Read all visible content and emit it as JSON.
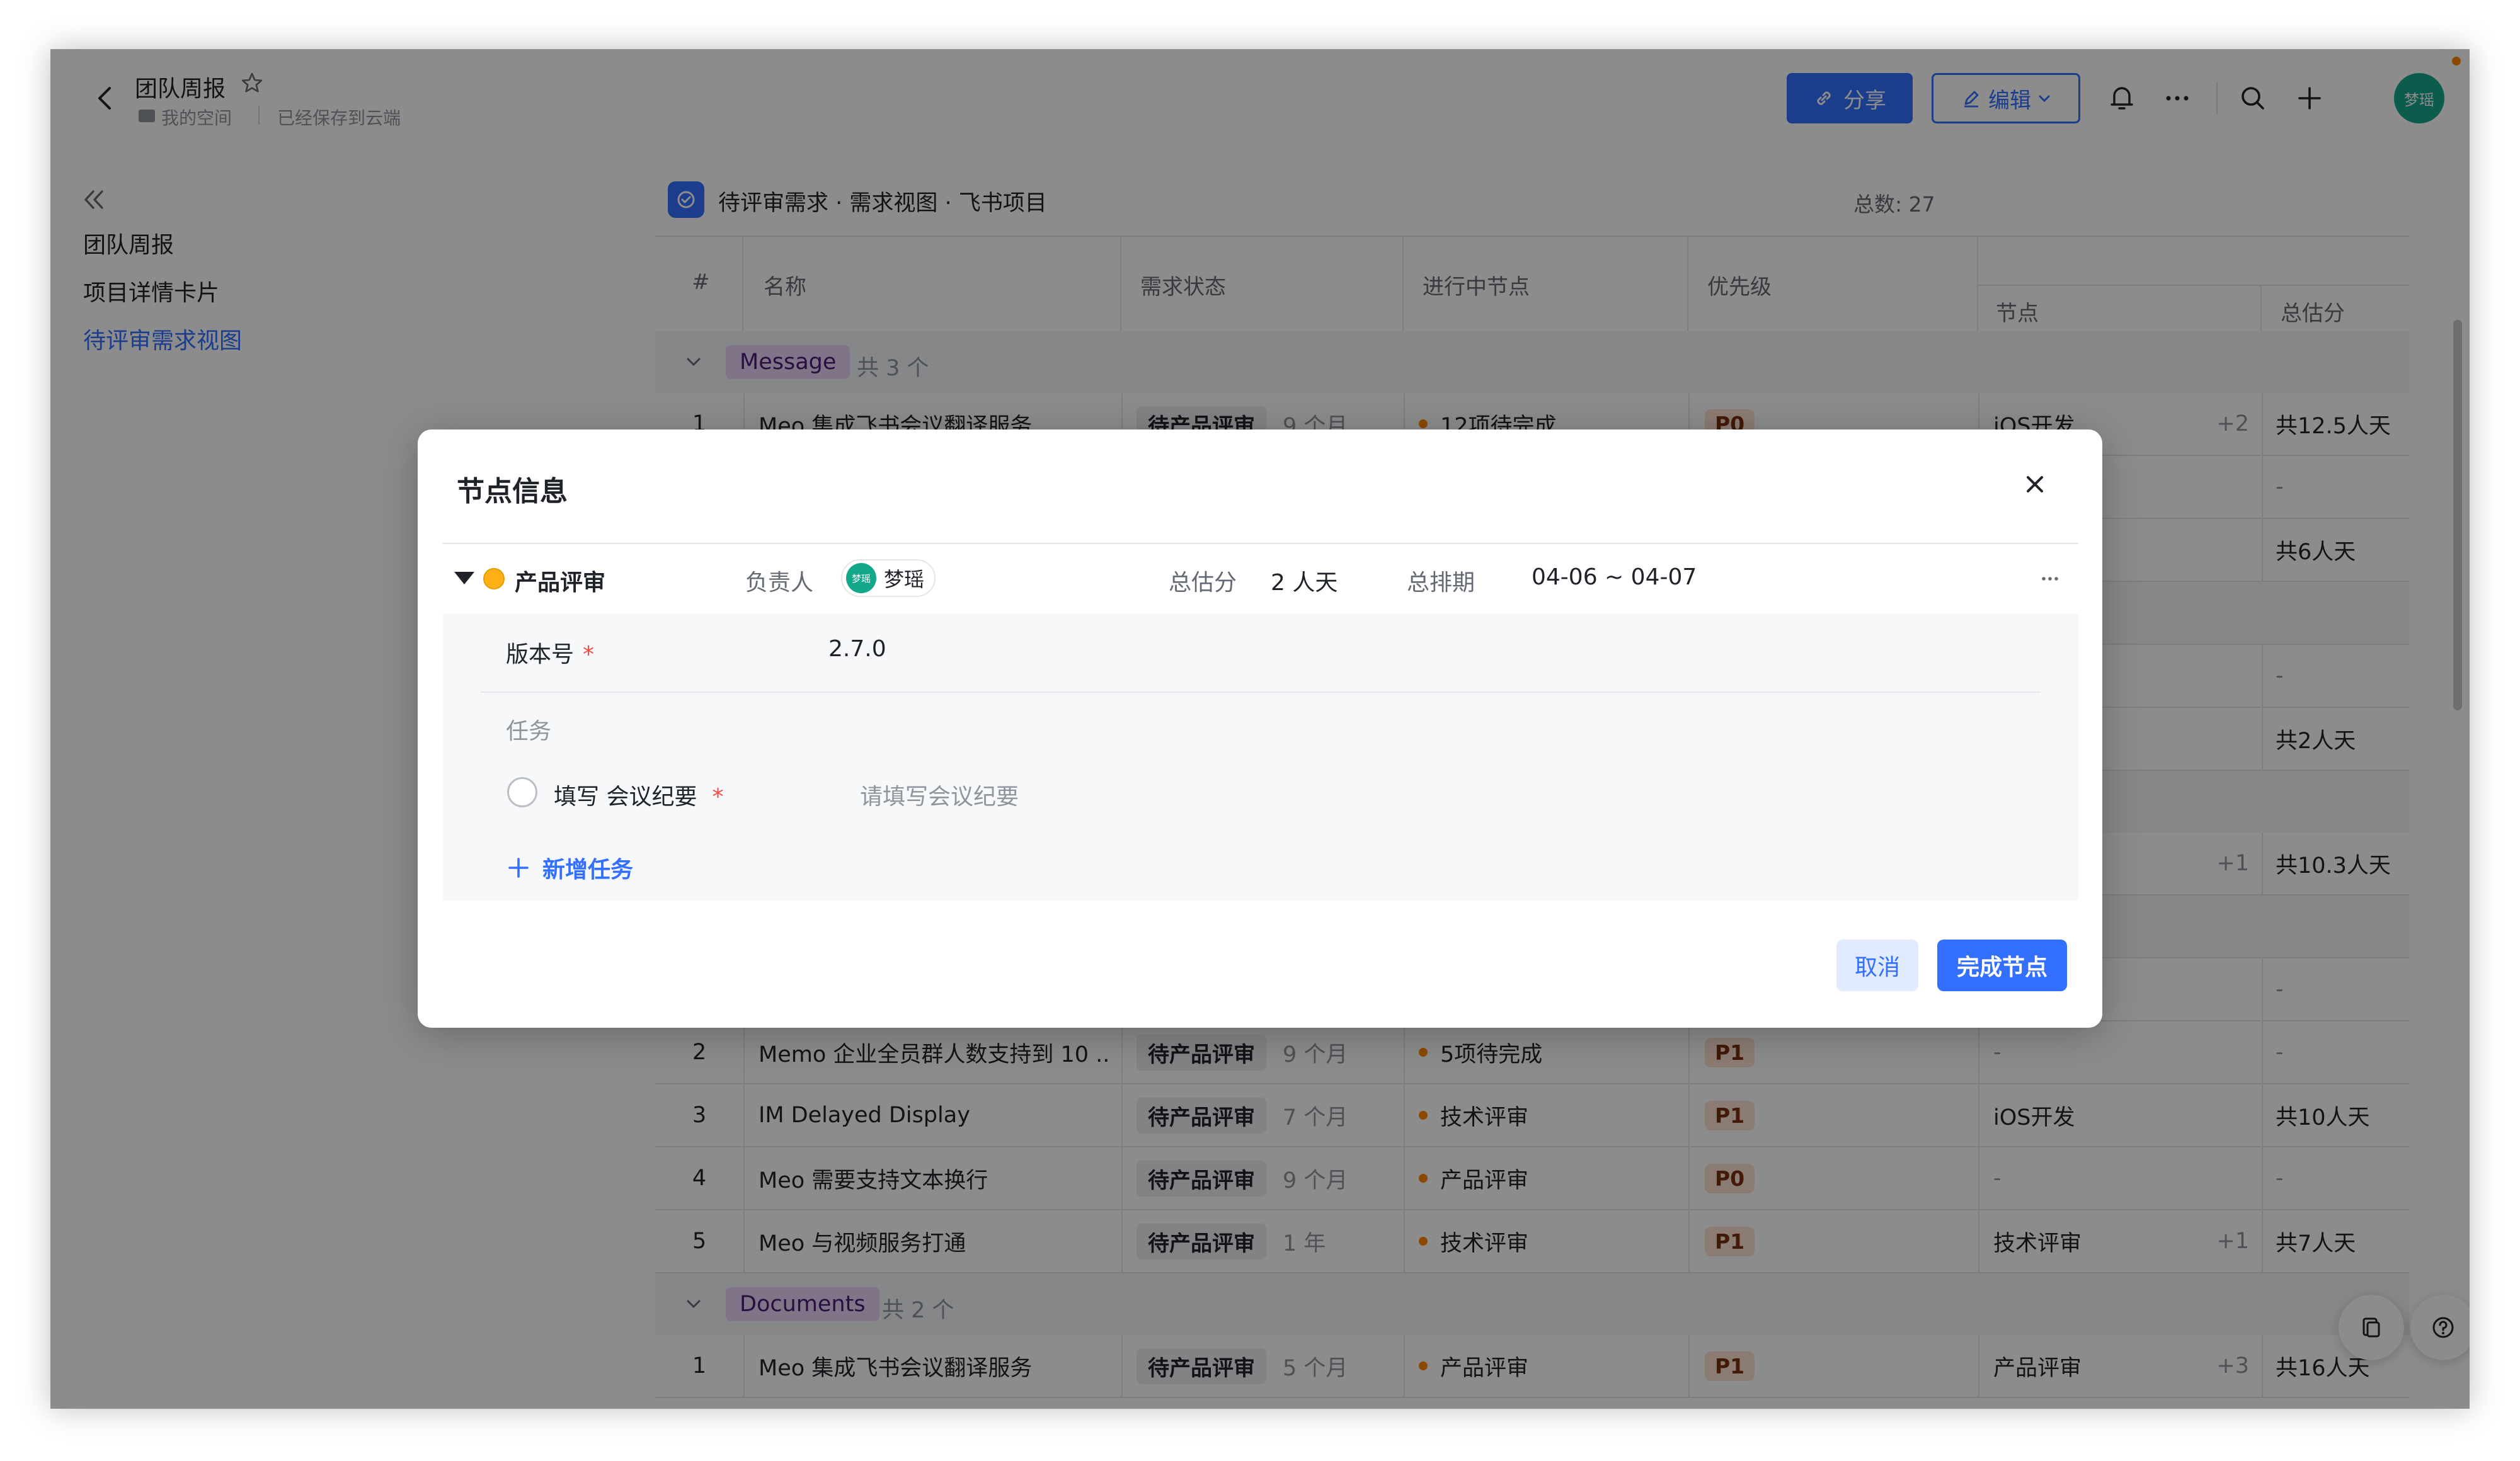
{
  "header": {
    "title": "团队周报",
    "space": "我的空间",
    "save_status": "已经保存到云端",
    "share_label": "分享",
    "edit_label": "编辑",
    "avatar_text": "梦瑶"
  },
  "sidebar": {
    "items": [
      {
        "label": "团队周报"
      },
      {
        "label": "项目详情卡片"
      },
      {
        "label": "待评审需求视图"
      }
    ]
  },
  "embed": {
    "title": "待评审需求 · 需求视图 · 飞书项目",
    "total": "总数: 27"
  },
  "table": {
    "columns": [
      "#",
      "名称",
      "需求状态",
      "进行中节点",
      "优先级",
      "节点",
      "总估分"
    ],
    "groups": [
      {
        "name": "Message",
        "count": "共 3 个",
        "rows": [
          {
            "no": "1",
            "name": "Meo 集成飞书会议翻译服务",
            "status": "待产品评审",
            "time": "9 个月",
            "node": "12项待完成",
            "priority": "P0",
            "stage": "iOS开发",
            "extra": "+2",
            "estimate": "共12.5人天"
          }
        ]
      }
    ],
    "partial_estimates": [
      "-",
      "共6人天",
      "-",
      "共2人天",
      "共10.3人天",
      "-"
    ],
    "partial_extra": "+1",
    "rows_lower": [
      {
        "no": "2",
        "name": "Memo 企业全员群人数支持到 10 ...",
        "status": "待产品评审",
        "time": "9 个月",
        "node": "5项待完成",
        "priority": "P1",
        "stage": "-",
        "extra": "",
        "estimate": "-"
      },
      {
        "no": "3",
        "name": "IM Delayed Display",
        "status": "待产品评审",
        "time": "7 个月",
        "node": "技术评审",
        "priority": "P1",
        "stage": "iOS开发",
        "extra": "",
        "estimate": "共10人天"
      },
      {
        "no": "4",
        "name": "Meo 需要支持文本换行",
        "status": "待产品评审",
        "time": "9 个月",
        "node": "产品评审",
        "priority": "P0",
        "stage": "-",
        "extra": "",
        "estimate": "-"
      },
      {
        "no": "5",
        "name": "Meo 与视频服务打通",
        "status": "待产品评审",
        "time": "1 年",
        "node": "技术评审",
        "priority": "P1",
        "stage": "技术评审",
        "extra": "+1",
        "estimate": "共7人天"
      }
    ],
    "group_documents": {
      "name": "Documents",
      "count": "共 2 个",
      "rows": [
        {
          "no": "1",
          "name": "Meo 集成飞书会议翻译服务",
          "status": "待产品评审",
          "time": "5 个月",
          "node": "产品评审",
          "priority": "P1",
          "stage": "产品评审",
          "extra": "+3",
          "estimate": "共16人天"
        }
      ]
    }
  },
  "modal": {
    "title": "节点信息",
    "node_name": "产品评审",
    "owner_label": "负责人",
    "owner_name": "梦瑶",
    "owner_avatar": "梦瑶",
    "estimate_label": "总估分",
    "estimate_value": "2 人天",
    "schedule_label": "总排期",
    "schedule_value": "04-06 ~ 04-07",
    "version_label": "版本号",
    "required_mark": "*",
    "version_value": "2.7.0",
    "tasks_label": "任务",
    "task_name": "填写 会议纪要",
    "task_placeholder": "请填写会议纪要",
    "add_task_label": "新增任务",
    "cancel_label": "取消",
    "complete_label": "完成节点"
  },
  "colors": {
    "primary": "#3370ff",
    "overlay": "rgba(0,0,0,0.45)",
    "node_dot": "#ffb017",
    "required": "#f54a45"
  }
}
